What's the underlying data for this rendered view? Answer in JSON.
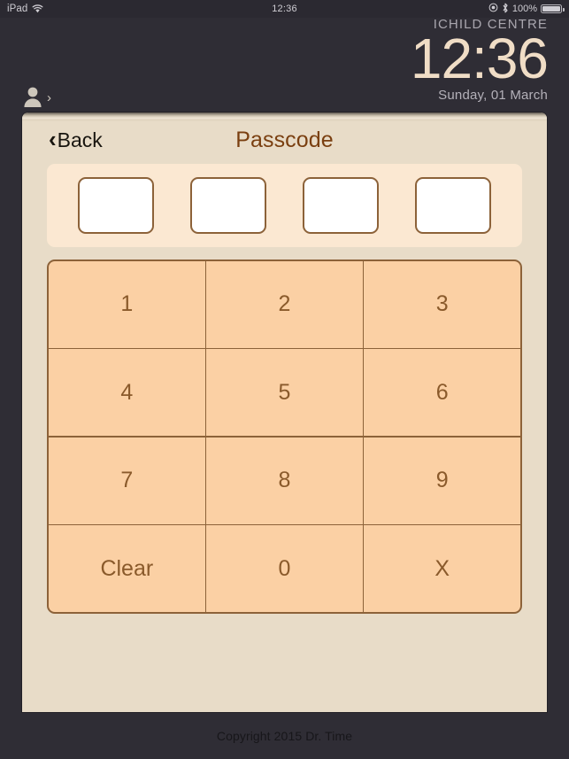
{
  "status_bar": {
    "device": "iPad",
    "wifi_icon": "wifi-icon",
    "time": "12:36",
    "location_icon": "location-services-icon",
    "bluetooth_icon": "bluetooth-icon",
    "battery_percent": "100%",
    "battery_icon": "battery-full-icon"
  },
  "lock_screen": {
    "centre_name": "ICHILD CENTRE",
    "time": "12:36",
    "date": "Sunday, 01 March",
    "user_icon": "person-icon",
    "user_chevron": "›"
  },
  "modal": {
    "back_label": "Back",
    "back_chevron": "‹",
    "title": "Passcode",
    "passcode": {
      "fields": [
        "",
        "",
        "",
        ""
      ],
      "placeholder": ""
    },
    "keypad": {
      "keys": [
        "1",
        "2",
        "3",
        "4",
        "5",
        "6",
        "7",
        "8",
        "9",
        "Clear",
        "0",
        "X"
      ]
    }
  },
  "footer": {
    "copyright": "Copyright 2015 Dr. Time"
  },
  "colors": {
    "background": "#2f2d35",
    "panel": "#e8dcc8",
    "panel_accent": "#fbe8d2",
    "key_fill": "#fbd0a4",
    "brown_border": "#8c6239",
    "title_brown": "#7a3f10",
    "clock_cream": "#f0ddc6"
  }
}
